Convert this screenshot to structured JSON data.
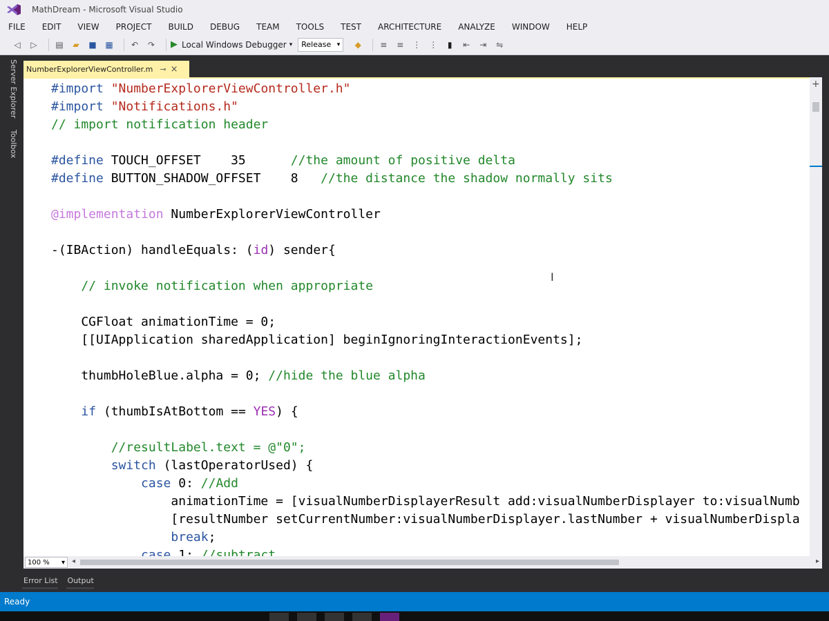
{
  "window": {
    "title": "MathDream - Microsoft Visual Studio"
  },
  "menu": {
    "items": [
      "FILE",
      "EDIT",
      "VIEW",
      "PROJECT",
      "BUILD",
      "DEBUG",
      "TEAM",
      "TOOLS",
      "TEST",
      "ARCHITECTURE",
      "ANALYZE",
      "WINDOW",
      "HELP"
    ]
  },
  "toolbar": {
    "debugger_label": "Local Windows Debugger",
    "configuration": "Release"
  },
  "side_panels": {
    "server_explorer": "Server Explorer",
    "toolbox": "Toolbox"
  },
  "editor": {
    "file_tab": "NumberExplorerViewController.m",
    "zoom": "100 %",
    "lines": [
      [
        {
          "t": "#import ",
          "c": "kw-pp"
        },
        {
          "t": "\"NumberExplorerViewController.h\"",
          "c": "str"
        }
      ],
      [
        {
          "t": "#import ",
          "c": "kw-pp"
        },
        {
          "t": "\"Notifications.h\"",
          "c": "str"
        }
      ],
      [
        {
          "t": "// import notification header",
          "c": "cm"
        }
      ],
      [],
      [
        {
          "t": "#define ",
          "c": "kw-pp"
        },
        {
          "t": "TOUCH_OFFSET    35      ",
          "c": ""
        },
        {
          "t": "//the amount of positive delta",
          "c": "cm"
        }
      ],
      [
        {
          "t": "#define ",
          "c": "kw-pp"
        },
        {
          "t": "BUTTON_SHADOW_OFFSET    8   ",
          "c": ""
        },
        {
          "t": "//the distance the shadow normally sits",
          "c": "cm"
        }
      ],
      [],
      [
        {
          "t": "@implementation ",
          "c": "attr"
        },
        {
          "t": "NumberExplorerViewController",
          "c": ""
        }
      ],
      [],
      [
        {
          "t": "-(IBAction) handleEquals: (",
          "c": ""
        },
        {
          "t": "id",
          "c": "kw-purple"
        },
        {
          "t": ") sender{",
          "c": ""
        }
      ],
      [],
      [
        {
          "t": "    ",
          "c": ""
        },
        {
          "t": "// invoke notification when appropriate",
          "c": "cm"
        }
      ],
      [],
      [
        {
          "t": "    CGFloat animationTime = 0;",
          "c": ""
        }
      ],
      [
        {
          "t": "    [[UIApplication sharedApplication] beginIgnoringInteractionEvents];",
          "c": ""
        }
      ],
      [],
      [
        {
          "t": "    thumbHoleBlue.alpha = 0; ",
          "c": ""
        },
        {
          "t": "//hide the blue alpha",
          "c": "cm"
        }
      ],
      [],
      [
        {
          "t": "    ",
          "c": ""
        },
        {
          "t": "if",
          "c": "kw"
        },
        {
          "t": " (thumbIsAtBottom == ",
          "c": ""
        },
        {
          "t": "YES",
          "c": "kw-purple"
        },
        {
          "t": ") {",
          "c": ""
        }
      ],
      [],
      [
        {
          "t": "        ",
          "c": ""
        },
        {
          "t": "//resultLabel.text = @\"0\";",
          "c": "cm"
        }
      ],
      [
        {
          "t": "        ",
          "c": ""
        },
        {
          "t": "switch",
          "c": "kw"
        },
        {
          "t": " (lastOperatorUsed) {",
          "c": ""
        }
      ],
      [
        {
          "t": "            ",
          "c": ""
        },
        {
          "t": "case",
          "c": "kw"
        },
        {
          "t": " 0: ",
          "c": ""
        },
        {
          "t": "//Add",
          "c": "cm"
        }
      ],
      [
        {
          "t": "                animationTime = [visualNumberDisplayerResult add:visualNumberDisplayer to:visualNumb",
          "c": ""
        }
      ],
      [
        {
          "t": "                [resultNumber setCurrentNumber:visualNumberDisplayer.lastNumber + visualNumberDispla",
          "c": ""
        }
      ],
      [
        {
          "t": "                ",
          "c": ""
        },
        {
          "t": "break",
          "c": "kw"
        },
        {
          "t": ";",
          "c": ""
        }
      ],
      [
        {
          "t": "            ",
          "c": ""
        },
        {
          "t": "case",
          "c": "kw"
        },
        {
          "t": " 1: ",
          "c": ""
        },
        {
          "t": "//subtract",
          "c": "cm"
        }
      ]
    ]
  },
  "bottom_tabs": [
    "Error List",
    "Output"
  ],
  "status": {
    "text": "Ready"
  },
  "colors": {
    "accent": "#007acc",
    "tab_active": "#fff1a8"
  }
}
